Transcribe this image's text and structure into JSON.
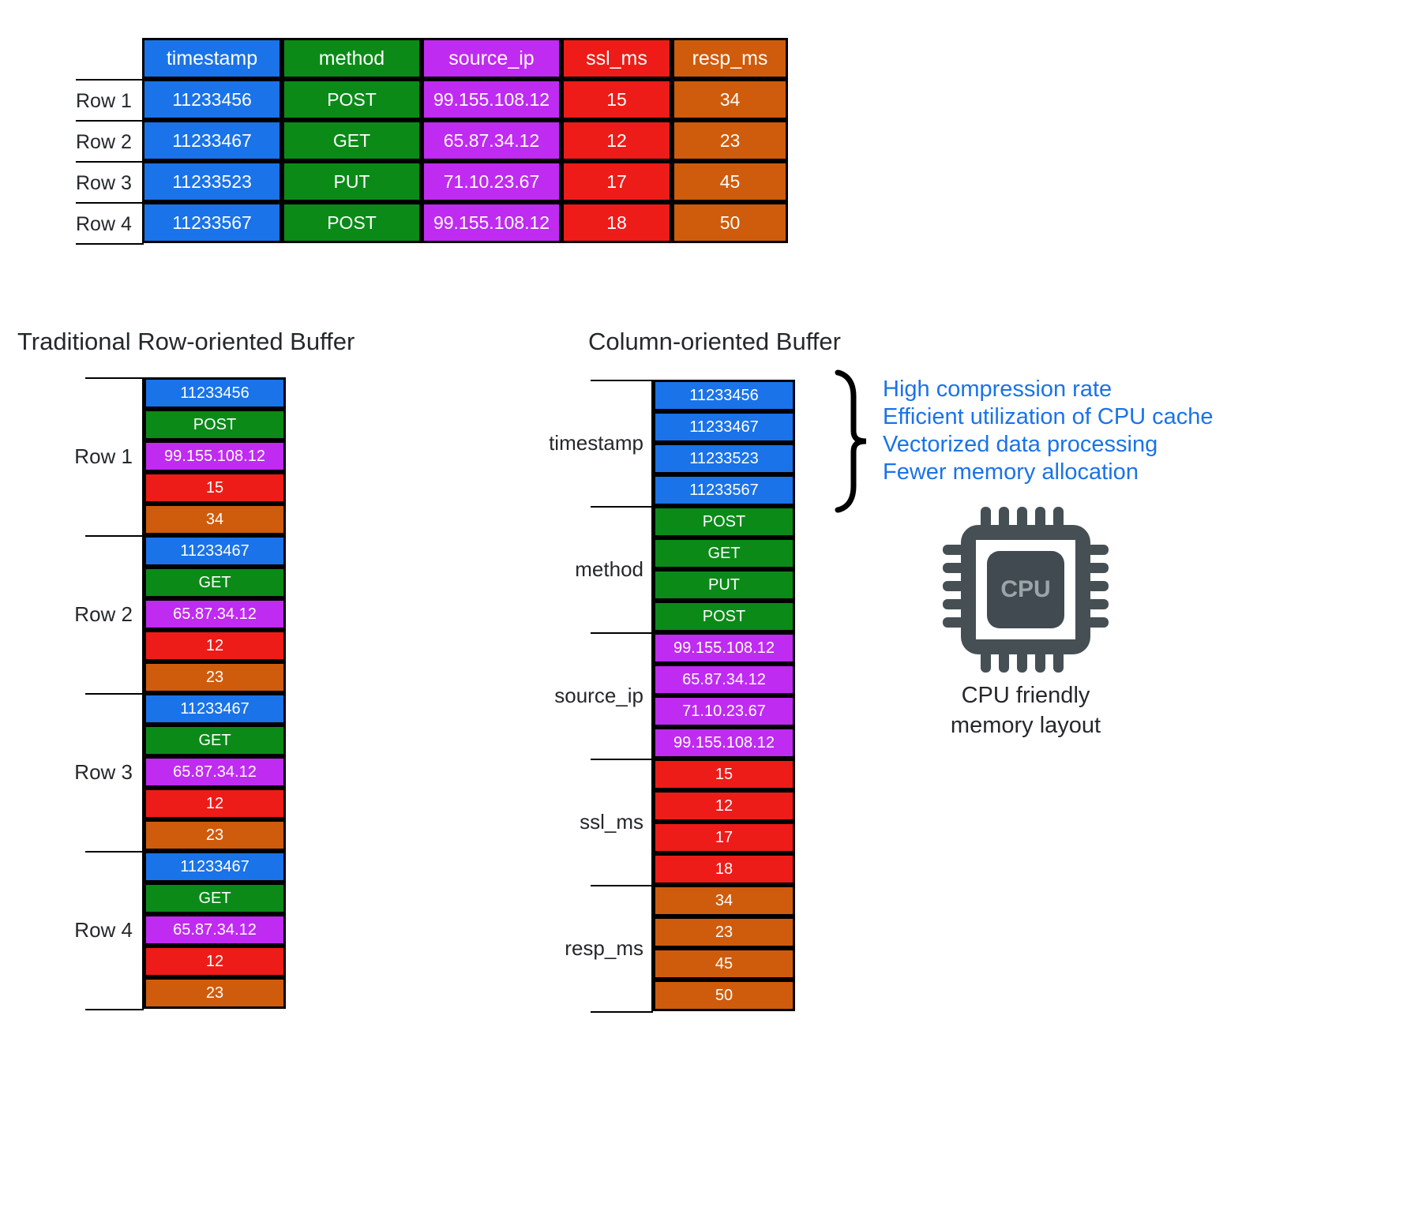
{
  "table": {
    "columns": [
      {
        "key": "timestamp",
        "label": "timestamp",
        "color": "#1a73e8"
      },
      {
        "key": "method",
        "label": "method",
        "color": "#0b8a18"
      },
      {
        "key": "source_ip",
        "label": "source_ip",
        "color": "#bf2bf0"
      },
      {
        "key": "ssl_ms",
        "label": "ssl_ms",
        "color": "#ed1c18"
      },
      {
        "key": "resp_ms",
        "label": "resp_ms",
        "color": "#ce5c0c"
      }
    ],
    "row_labels": [
      "Row 1",
      "Row 2",
      "Row 3",
      "Row 4"
    ],
    "rows": [
      {
        "timestamp": "11233456",
        "method": "POST",
        "source_ip": "99.155.108.12",
        "ssl_ms": "15",
        "resp_ms": "34"
      },
      {
        "timestamp": "11233467",
        "method": "GET",
        "source_ip": "65.87.34.12",
        "ssl_ms": "12",
        "resp_ms": "23"
      },
      {
        "timestamp": "11233523",
        "method": "PUT",
        "source_ip": "71.10.23.67",
        "ssl_ms": "17",
        "resp_ms": "45"
      },
      {
        "timestamp": "11233567",
        "method": "POST",
        "source_ip": "99.155.108.12",
        "ssl_ms": "18",
        "resp_ms": "50"
      }
    ]
  },
  "row_buffer": {
    "title": "Traditional Row-oriented Buffer",
    "groups": [
      {
        "label": "Row 1",
        "cells": [
          {
            "type": "timestamp",
            "value": "11233456"
          },
          {
            "type": "method",
            "value": "POST"
          },
          {
            "type": "source_ip",
            "value": "99.155.108.12"
          },
          {
            "type": "ssl_ms",
            "value": "15"
          },
          {
            "type": "resp_ms",
            "value": "34"
          }
        ]
      },
      {
        "label": "Row 2",
        "cells": [
          {
            "type": "timestamp",
            "value": "11233467"
          },
          {
            "type": "method",
            "value": "GET"
          },
          {
            "type": "source_ip",
            "value": "65.87.34.12"
          },
          {
            "type": "ssl_ms",
            "value": "12"
          },
          {
            "type": "resp_ms",
            "value": "23"
          }
        ]
      },
      {
        "label": "Row 3",
        "cells": [
          {
            "type": "timestamp",
            "value": "11233467"
          },
          {
            "type": "method",
            "value": "GET"
          },
          {
            "type": "source_ip",
            "value": "65.87.34.12"
          },
          {
            "type": "ssl_ms",
            "value": "12"
          },
          {
            "type": "resp_ms",
            "value": "23"
          }
        ]
      },
      {
        "label": "Row 4",
        "cells": [
          {
            "type": "timestamp",
            "value": "11233467"
          },
          {
            "type": "method",
            "value": "GET"
          },
          {
            "type": "source_ip",
            "value": "65.87.34.12"
          },
          {
            "type": "ssl_ms",
            "value": "12"
          },
          {
            "type": "resp_ms",
            "value": "23"
          }
        ]
      }
    ]
  },
  "column_buffer": {
    "title": "Column-oriented Buffer",
    "groups": [
      {
        "label": "timestamp",
        "type": "timestamp",
        "values": [
          "11233456",
          "11233467",
          "11233523",
          "11233567"
        ]
      },
      {
        "label": "method",
        "type": "method",
        "values": [
          "POST",
          "GET",
          "PUT",
          "POST"
        ]
      },
      {
        "label": "source_ip",
        "type": "source_ip",
        "values": [
          "99.155.108.12",
          "65.87.34.12",
          "71.10.23.67",
          "99.155.108.12"
        ]
      },
      {
        "label": "ssl_ms",
        "type": "ssl_ms",
        "values": [
          "15",
          "12",
          "17",
          "18"
        ]
      },
      {
        "label": "resp_ms",
        "type": "resp_ms",
        "values": [
          "34",
          "23",
          "45",
          "50"
        ]
      }
    ]
  },
  "benefits": {
    "accent_color": "#1a73e8",
    "items": [
      "High compression rate",
      "Efficient utilization of CPU cache",
      "Vectorized data processing",
      "Fewer memory allocation"
    ]
  },
  "cpu": {
    "icon": "cpu-chip-icon",
    "chip_label": "CPU",
    "caption_line1": "CPU friendly",
    "caption_line2": "memory layout",
    "chip_color": "#464f54",
    "chip_label_color": "#9aa5aa"
  }
}
